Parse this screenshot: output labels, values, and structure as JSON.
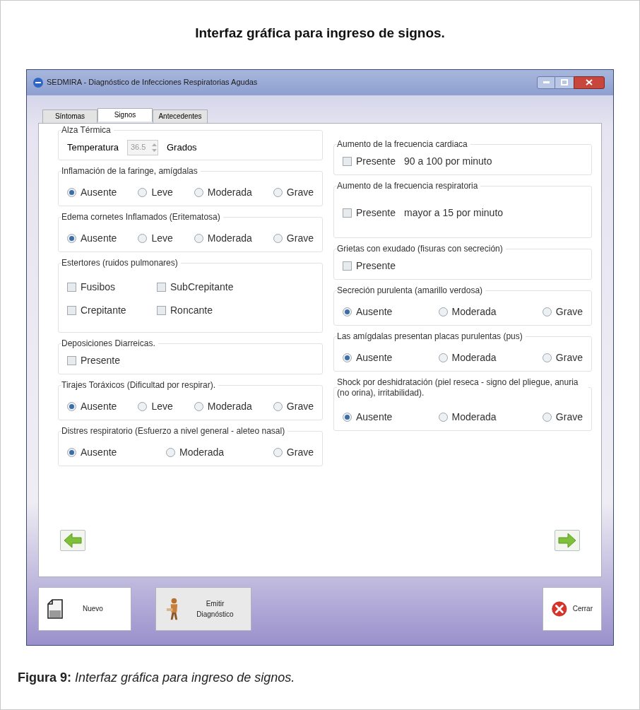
{
  "page_title": "Interfaz gráfica para ingreso de signos.",
  "window": {
    "title": "SEDMIRA - Diagnóstico de Infecciones Respiratorias Agudas"
  },
  "tabs": [
    {
      "label": "Síntomas",
      "selected": false
    },
    {
      "label": "Signos",
      "selected": true
    },
    {
      "label": "Antecedentes",
      "selected": false
    }
  ],
  "left_groups": [
    {
      "kind": "spin",
      "title": "Alza Térmica",
      "label": "Temperatura",
      "value": "36.5",
      "disabled": true,
      "unit": "Grados"
    },
    {
      "kind": "radio",
      "title": "Inflamación de la faringe, amígdalas",
      "options": [
        {
          "label": "Ausente",
          "selected": true
        },
        {
          "label": "Leve",
          "selected": false
        },
        {
          "label": "Moderada",
          "selected": false
        },
        {
          "label": "Grave",
          "selected": false
        }
      ]
    },
    {
      "kind": "radio",
      "title": "Edema cornetes Inflamados (Eritematosa)",
      "options": [
        {
          "label": "Ausente",
          "selected": true
        },
        {
          "label": "Leve",
          "selected": false
        },
        {
          "label": "Moderada",
          "selected": false
        },
        {
          "label": "Grave",
          "selected": false
        }
      ]
    },
    {
      "kind": "checkgrid",
      "title": "Estertores (ruidos pulmonares)",
      "items": [
        {
          "label": "Fusibos",
          "checked": false
        },
        {
          "label": "SubCrepitante",
          "checked": false
        },
        {
          "label": "Crepitante",
          "checked": false
        },
        {
          "label": "Roncante",
          "checked": false
        }
      ]
    },
    {
      "kind": "check",
      "title": "Deposiciones Diarreicas.",
      "items": [
        {
          "label": "Presente",
          "checked": false
        }
      ]
    },
    {
      "kind": "radio",
      "title": "Tirajes Toráxicos (Dificultad por respirar).",
      "options": [
        {
          "label": "Ausente",
          "selected": true
        },
        {
          "label": "Leve",
          "selected": false
        },
        {
          "label": "Moderada",
          "selected": false
        },
        {
          "label": "Grave",
          "selected": false
        }
      ]
    },
    {
      "kind": "radio",
      "title": "Distres respiratorio  (Esfuerzo a nivel general - aleteo nasal)",
      "options": [
        {
          "label": "Ausente",
          "selected": true
        },
        {
          "label": "Moderada",
          "selected": false
        },
        {
          "label": "Grave",
          "selected": false
        }
      ]
    }
  ],
  "right_groups": [
    {
      "kind": "check",
      "title": "Aumento de la frecuencia cardiaca",
      "items": [
        {
          "label": "Presente",
          "checked": false
        }
      ],
      "note": "90 a 100 por minuto"
    },
    {
      "kind": "check",
      "title": "Aumento de la frecuencia respiratoria",
      "items": [
        {
          "label": "Presente",
          "checked": false
        }
      ],
      "note": "mayor a 15 por minuto"
    },
    {
      "kind": "check",
      "title": "Grietas con exudado (fisuras con secreción)",
      "items": [
        {
          "label": "Presente",
          "checked": false
        }
      ]
    },
    {
      "kind": "radio",
      "title": "Secreción purulenta (amarillo verdosa)",
      "options": [
        {
          "label": "Ausente",
          "selected": true
        },
        {
          "label": "Moderada",
          "selected": false
        },
        {
          "label": "Grave",
          "selected": false
        }
      ]
    },
    {
      "kind": "radio",
      "title": "Las amígdalas presentan placas purulentas (pus)",
      "options": [
        {
          "label": "Ausente",
          "selected": true
        },
        {
          "label": "Moderada",
          "selected": false
        },
        {
          "label": "Grave",
          "selected": false
        }
      ]
    },
    {
      "kind": "radio",
      "title": "Shock por deshidratación (piel reseca - signo del pliegue, anuria (no orina), irritabilidad).",
      "options": [
        {
          "label": "Ausente",
          "selected": true
        },
        {
          "label": "Moderada",
          "selected": false
        },
        {
          "label": "Grave",
          "selected": false
        }
      ]
    }
  ],
  "nav_buttons": [
    {
      "kind": "back"
    },
    {
      "kind": "next"
    }
  ],
  "buttons": [
    {
      "kind": "new",
      "label": "Nuevo"
    },
    {
      "kind": "diagnose",
      "label": "Emitir Diagnóstico"
    },
    {
      "kind": "close",
      "label": "Cerrar"
    }
  ],
  "caption": "**Figura 9:** *Interfaz gráfica para ingreso de signos.*"
}
